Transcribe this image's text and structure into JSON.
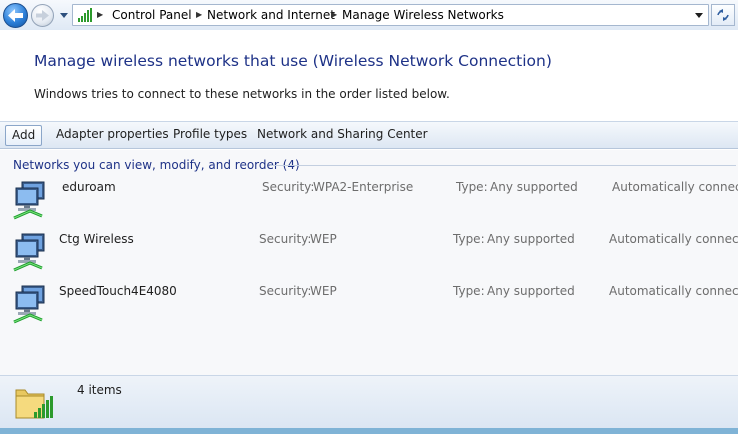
{
  "address_bar": {
    "breadcrumbs": [
      "Control Panel",
      "Network and Internet",
      "Manage Wireless Networks"
    ]
  },
  "header": {
    "title": "Manage wireless networks that use (Wireless Network Connection)",
    "subtitle": "Windows tries to connect to these networks in the order listed below."
  },
  "toolbar": {
    "add": "Add",
    "adapter_properties": "Adapter properties",
    "profile_types": "Profile types",
    "network_sharing_center": "Network and Sharing Center"
  },
  "list": {
    "group_header": "Networks you can view, modify, and reorder (4)",
    "security_label": "Security:",
    "type_label": "Type:",
    "networks": [
      {
        "name": "eduroam",
        "security": "WPA2-Enterprise",
        "type": "Any supported",
        "mode": "Automatically connect"
      },
      {
        "name": "Ctg Wireless",
        "security": "WEP",
        "type": "Any supported",
        "mode": "Automatically connect"
      },
      {
        "name": "SpeedTouch4E4080",
        "security": "WEP",
        "type": "Any supported",
        "mode": "Automatically connect"
      }
    ]
  },
  "details": {
    "item_count": "4 items"
  },
  "icons": {
    "back": "back-arrow-icon",
    "forward": "forward-arrow-icon",
    "network": "wireless-network-icon",
    "folder": "network-folder-icon",
    "refresh": "refresh-icon"
  },
  "colors": {
    "title": "#1e3287",
    "link_blue": "#1e3287",
    "bottom_strip": "#7fb3d6"
  }
}
